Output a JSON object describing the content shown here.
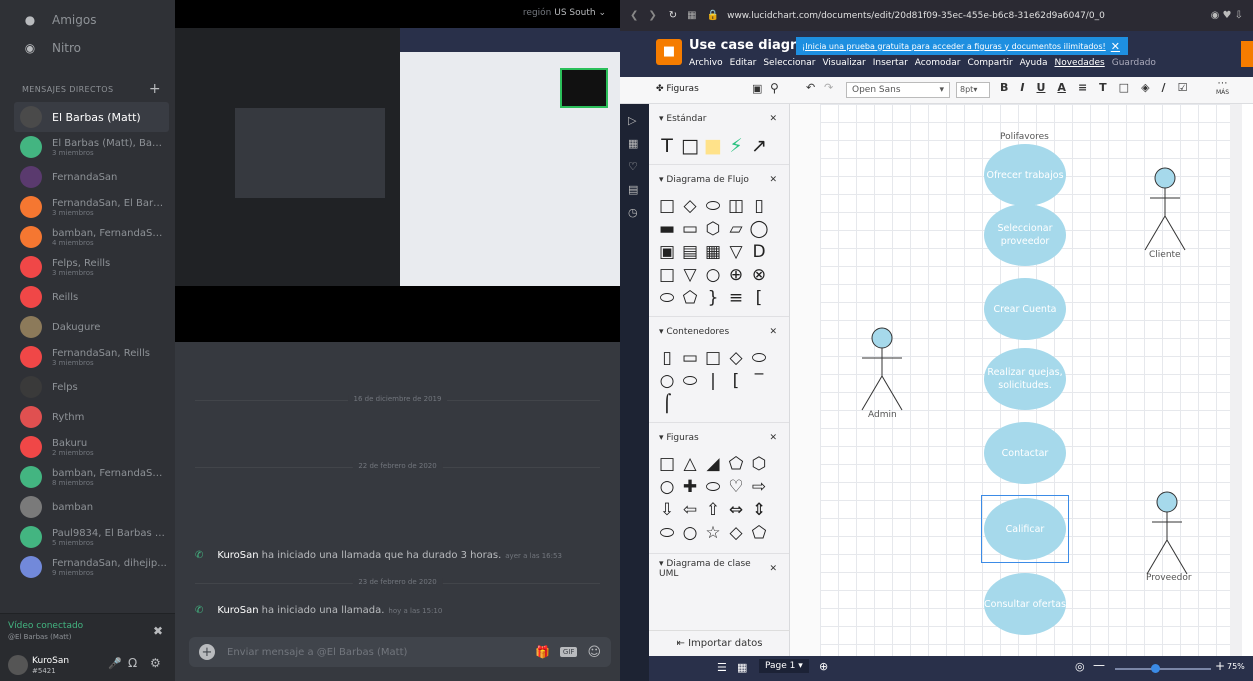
{
  "discord": {
    "nav": [
      {
        "label": "Amigos",
        "icon": "friends-icon"
      },
      {
        "label": "Nitro",
        "icon": "nitro-icon"
      }
    ],
    "dm_header": "MENSAJES DIRECTOS",
    "dm_add": "+",
    "dms": [
      {
        "name": "El Barbas (Matt)",
        "sub": "",
        "color": "#4a4a4a",
        "active": true
      },
      {
        "name": "El Barbas (Matt), Bak...",
        "sub": "3 miembros",
        "color": "#43b581"
      },
      {
        "name": "FernandaSan",
        "sub": "",
        "color": "#5a3a6e"
      },
      {
        "name": "FernandaSan, El Barb...",
        "sub": "3 miembros",
        "color": "#f57731"
      },
      {
        "name": "bamban, FernandaSa...",
        "sub": "4 miembros",
        "color": "#f57731"
      },
      {
        "name": "Felps, Reills",
        "sub": "3 miembros",
        "color": "#f04747"
      },
      {
        "name": "Reills",
        "sub": "",
        "color": "#f04747"
      },
      {
        "name": "Dakugure",
        "sub": "",
        "color": "#8c7a5a"
      },
      {
        "name": "FernandaSan, Reills",
        "sub": "3 miembros",
        "color": "#f04747"
      },
      {
        "name": "Felps",
        "sub": "",
        "color": "#3a3a3a"
      },
      {
        "name": "Rythm",
        "sub": "",
        "color": "#e05050"
      },
      {
        "name": "Bakuru",
        "sub": "2 miembros",
        "color": "#f04747"
      },
      {
        "name": "bamban, FernandaSa...",
        "sub": "8 miembros",
        "color": "#43b581"
      },
      {
        "name": "bamban",
        "sub": "",
        "color": "#7a7a7a"
      },
      {
        "name": "Paul9834, El Barbas (...",
        "sub": "5 miembros",
        "color": "#43b581"
      },
      {
        "name": "FernandaSan, dihejip...",
        "sub": "9 miembros",
        "color": "#7289da"
      }
    ],
    "voice_status": "Vídeo conectado",
    "voice_channel": "@El Barbas (Matt)",
    "user": {
      "name": "KuroSan",
      "tag": "#5421"
    },
    "region_label": "región",
    "region_value": "US South",
    "separators": [
      "16 de diciembre de 2019",
      "22 de febrero de 2020",
      "23 de febrero de 2020"
    ],
    "messages": [
      {
        "user": "KuroSan",
        "text": "ha iniciado una llamada que ha durado 3 horas.",
        "ts": "ayer a las 16:53"
      },
      {
        "user": "KuroSan",
        "text": "ha iniciado una llamada.",
        "ts": "hoy a las 15:10"
      }
    ],
    "composer_placeholder": "Enviar mensaje a @El Barbas (Matt)",
    "gif": "GIF"
  },
  "browser": {
    "url": "www.lucidchart.com/documents/edit/20d81f09-35ec-455e-b6c8-31e62d9a6047/0_0",
    "doc_title": "Use case diagram",
    "banner": "¡Inicia una prueba gratuita para acceder a figuras y documentos ilimitados!",
    "menus": [
      "Archivo",
      "Editar",
      "Seleccionar",
      "Visualizar",
      "Insertar",
      "Acomodar",
      "Compartir",
      "Ayuda",
      "Novedades",
      "Guardado"
    ],
    "figuras_label": "Figuras",
    "font": "Open Sans",
    "font_size": "8pt",
    "mas": "MÁS",
    "sections": [
      "Estándar",
      "Diagrama de Flujo",
      "Contenedores",
      "Figuras",
      "Diagrama de clase UML"
    ],
    "import": "Importar datos",
    "page": "Page 1",
    "zoom": "75%",
    "diagram": {
      "title": "Polifavores",
      "ovals": [
        "Ofrecer trabajos",
        "Seleccionar proveedor",
        "Crear Cuenta",
        "Realizar quejas, solicitudes.",
        "Contactar",
        "Calificar",
        "Consultar ofertas"
      ],
      "actors": [
        "Cliente",
        "Admin",
        "Proveedor"
      ]
    }
  }
}
